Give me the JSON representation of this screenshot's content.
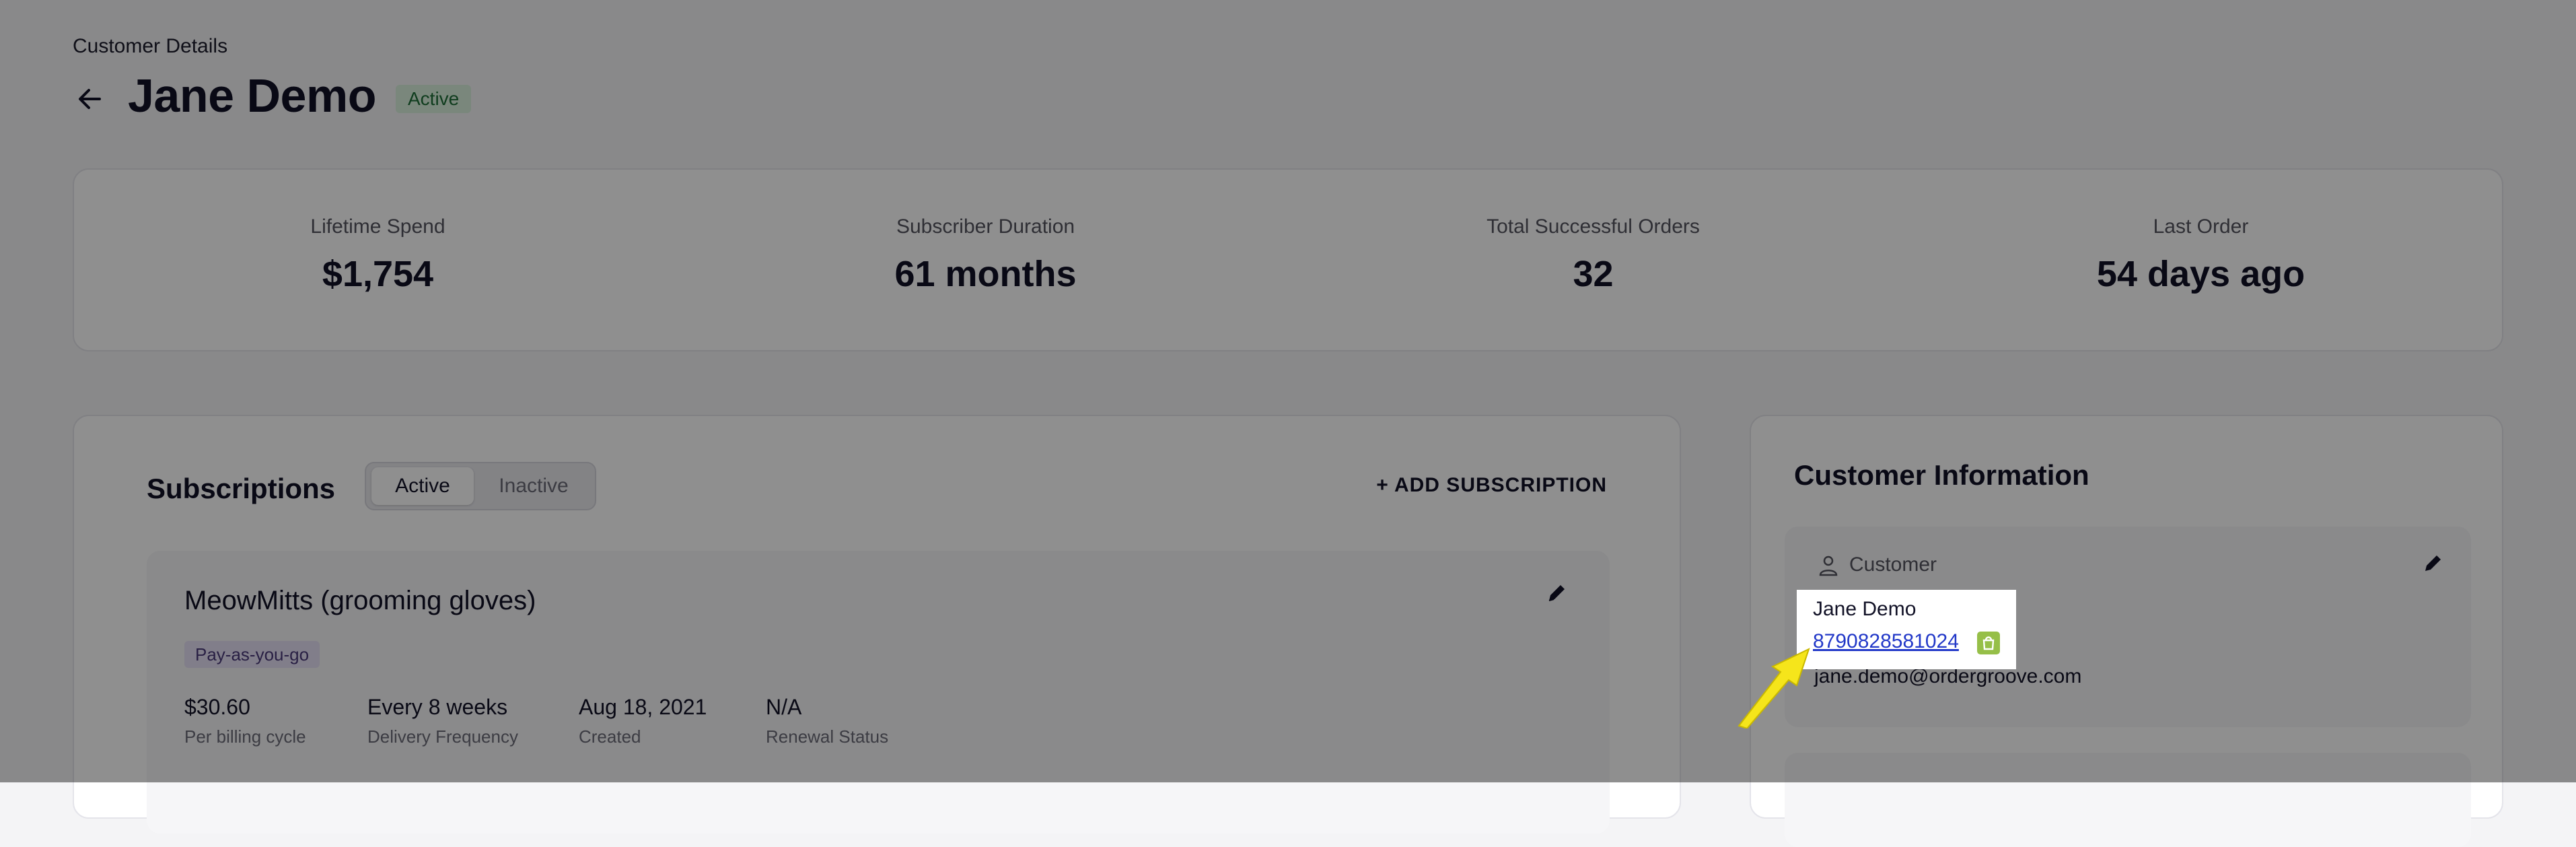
{
  "page": {
    "eyebrow": "Customer Details",
    "title": "Jane Demo",
    "status_badge": "Active",
    "back_icon": "arrow-left-icon"
  },
  "stats": [
    {
      "label": "Lifetime Spend",
      "value": "$1,754"
    },
    {
      "label": "Subscriber Duration",
      "value": "61 months"
    },
    {
      "label": "Total Successful Orders",
      "value": "32"
    },
    {
      "label": "Last Order",
      "value": "54 days ago"
    }
  ],
  "subscriptions": {
    "title": "Subscriptions",
    "tabs": [
      {
        "label": "Active",
        "selected": true
      },
      {
        "label": "Inactive",
        "selected": false
      }
    ],
    "add_label": "+ ADD SUBSCRIPTION",
    "items": [
      {
        "name": "MeowMitts (grooming gloves)",
        "badge": "Pay-as-you-go",
        "meta": [
          {
            "value": "$30.60",
            "label": "Per billing cycle"
          },
          {
            "value": "Every 8 weeks",
            "label": "Delivery Frequency"
          },
          {
            "value": "Aug 18, 2021",
            "label": "Created"
          },
          {
            "value": "N/A",
            "label": "Renewal Status"
          }
        ]
      }
    ]
  },
  "customer_info": {
    "title": "Customer Information",
    "section_label": "Customer",
    "section_icon": "person-icon",
    "name": "Jane Demo",
    "phone": "8790828581024",
    "email": "jane.demo@ordergroove.com",
    "store_icon": "shopify-bag-icon"
  },
  "colors": {
    "accent_link": "#2238c8",
    "active_badge_bg": "#d9f1de",
    "paygo_badge_bg": "#e6e0f6",
    "callout_arrow": "#f5e51b",
    "overlay": "rgba(0,0,0,0.44)"
  }
}
